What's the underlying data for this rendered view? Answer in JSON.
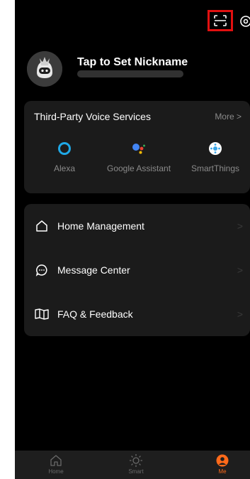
{
  "header": {
    "scan_icon": "scan-icon",
    "settings_icon": "settings-icon",
    "highlight_color": "#e11010"
  },
  "profile": {
    "nickname": "Tap to Set Nickname",
    "email": "",
    "avatar_icon": "robot-avatar"
  },
  "voice_services": {
    "title": "Third-Party Voice Services",
    "more_label": "More >",
    "items": [
      {
        "label": "Alexa",
        "icon": "alexa-icon",
        "color": "#1fa8e6"
      },
      {
        "label": "Google Assistant",
        "icon": "google-assistant-icon",
        "color": "#4285f4"
      },
      {
        "label": "SmartThings",
        "icon": "smartthings-icon",
        "color": "#3aa6e8"
      }
    ]
  },
  "menu": {
    "items": [
      {
        "label": "Home Management",
        "icon": "home-icon"
      },
      {
        "label": "Message Center",
        "icon": "message-icon"
      },
      {
        "label": "FAQ & Feedback",
        "icon": "book-icon"
      }
    ],
    "chevron": ">"
  },
  "bottom_nav": {
    "items": [
      {
        "label": "Home",
        "icon": "home-outline-icon",
        "active": false
      },
      {
        "label": "Smart",
        "icon": "sun-icon",
        "active": false
      },
      {
        "label": "Me",
        "icon": "person-icon",
        "active": true
      }
    ],
    "active_color": "#ff6a1a"
  }
}
